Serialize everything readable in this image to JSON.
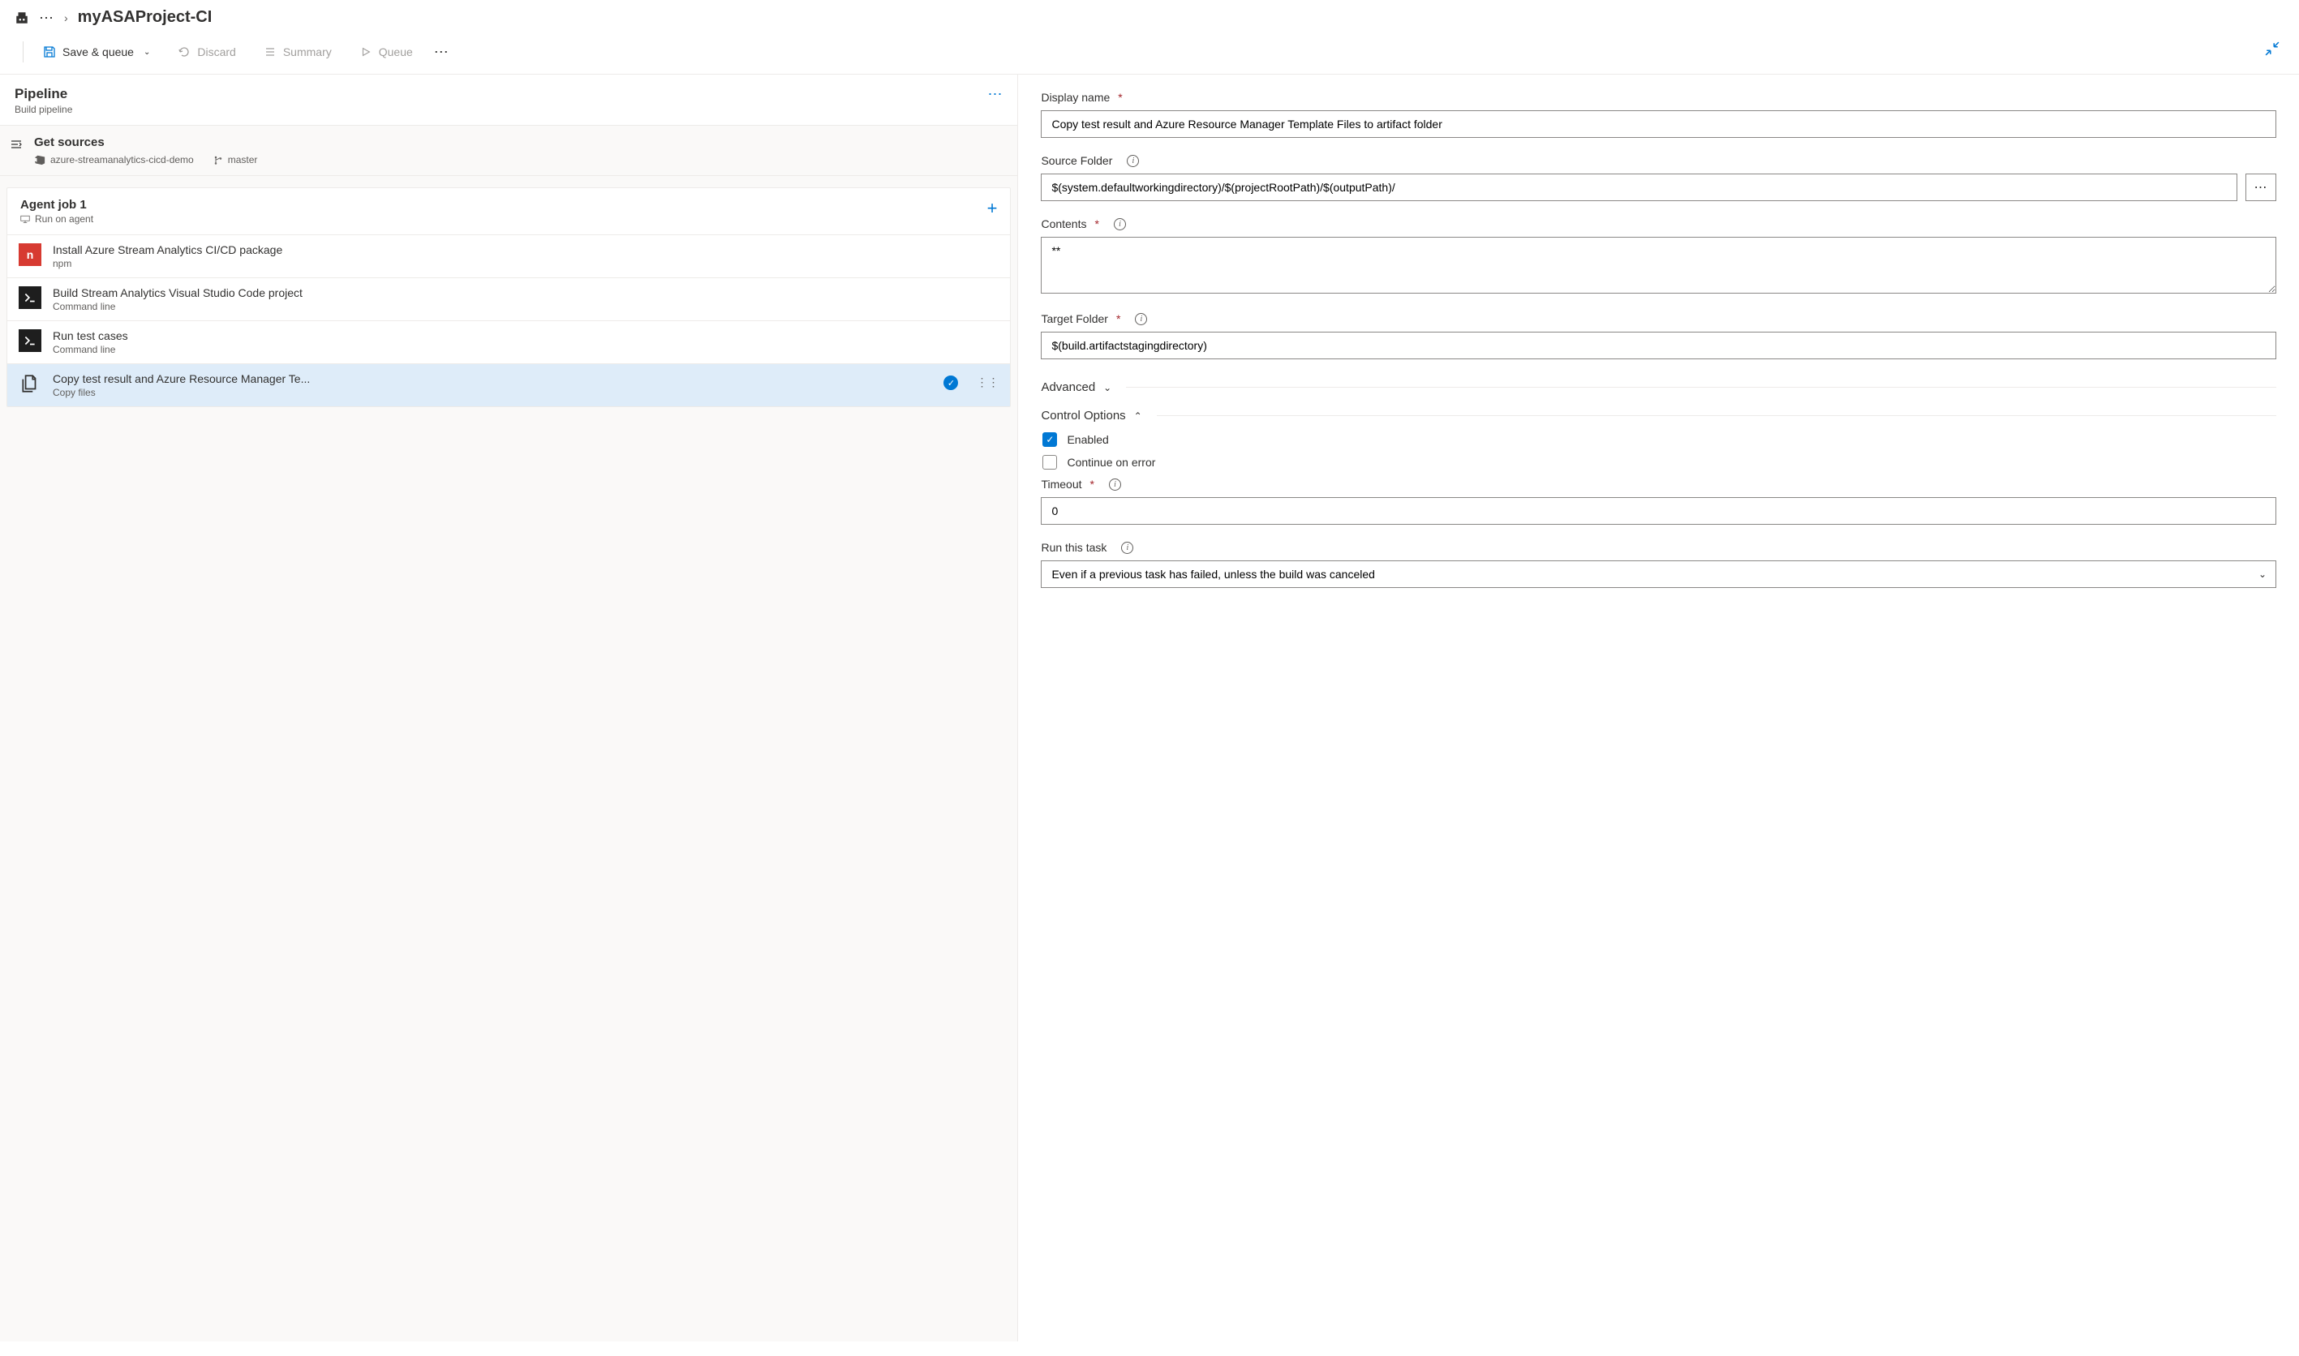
{
  "breadcrumb": {
    "project": "myASAProject-CI"
  },
  "toolbar": {
    "save_queue": "Save & queue",
    "discard": "Discard",
    "summary": "Summary",
    "queue": "Queue"
  },
  "pipeline": {
    "title": "Pipeline",
    "subtitle": "Build pipeline"
  },
  "sources": {
    "title": "Get sources",
    "repo": "azure-streamanalytics-cicd-demo",
    "branch": "master"
  },
  "job": {
    "title": "Agent job 1",
    "subtitle": "Run on agent"
  },
  "tasks": [
    {
      "title": "Install Azure Stream Analytics CI/CD package",
      "sub": "npm",
      "icon": "npm"
    },
    {
      "title": "Build Stream Analytics Visual Studio Code project",
      "sub": "Command line",
      "icon": "term"
    },
    {
      "title": "Run test cases",
      "sub": "Command line",
      "icon": "term"
    },
    {
      "title": "Copy test result and Azure Resource Manager Te...",
      "sub": "Copy files",
      "icon": "copy",
      "selected": true
    }
  ],
  "form": {
    "displayName": {
      "label": "Display name",
      "value": "Copy test result and Azure Resource Manager Template Files to artifact folder"
    },
    "sourceFolder": {
      "label": "Source Folder",
      "value": "$(system.defaultworkingdirectory)/$(projectRootPath)/$(outputPath)/"
    },
    "contents": {
      "label": "Contents",
      "value": "**"
    },
    "targetFolder": {
      "label": "Target Folder",
      "value": "$(build.artifactstagingdirectory)"
    },
    "advanced": "Advanced",
    "controlOptions": "Control Options",
    "enabled": {
      "label": "Enabled",
      "checked": true
    },
    "continueOnError": {
      "label": "Continue on error",
      "checked": false
    },
    "timeout": {
      "label": "Timeout",
      "value": "0"
    },
    "runThisTask": {
      "label": "Run this task",
      "value": "Even if a previous task has failed, unless the build was canceled"
    }
  }
}
